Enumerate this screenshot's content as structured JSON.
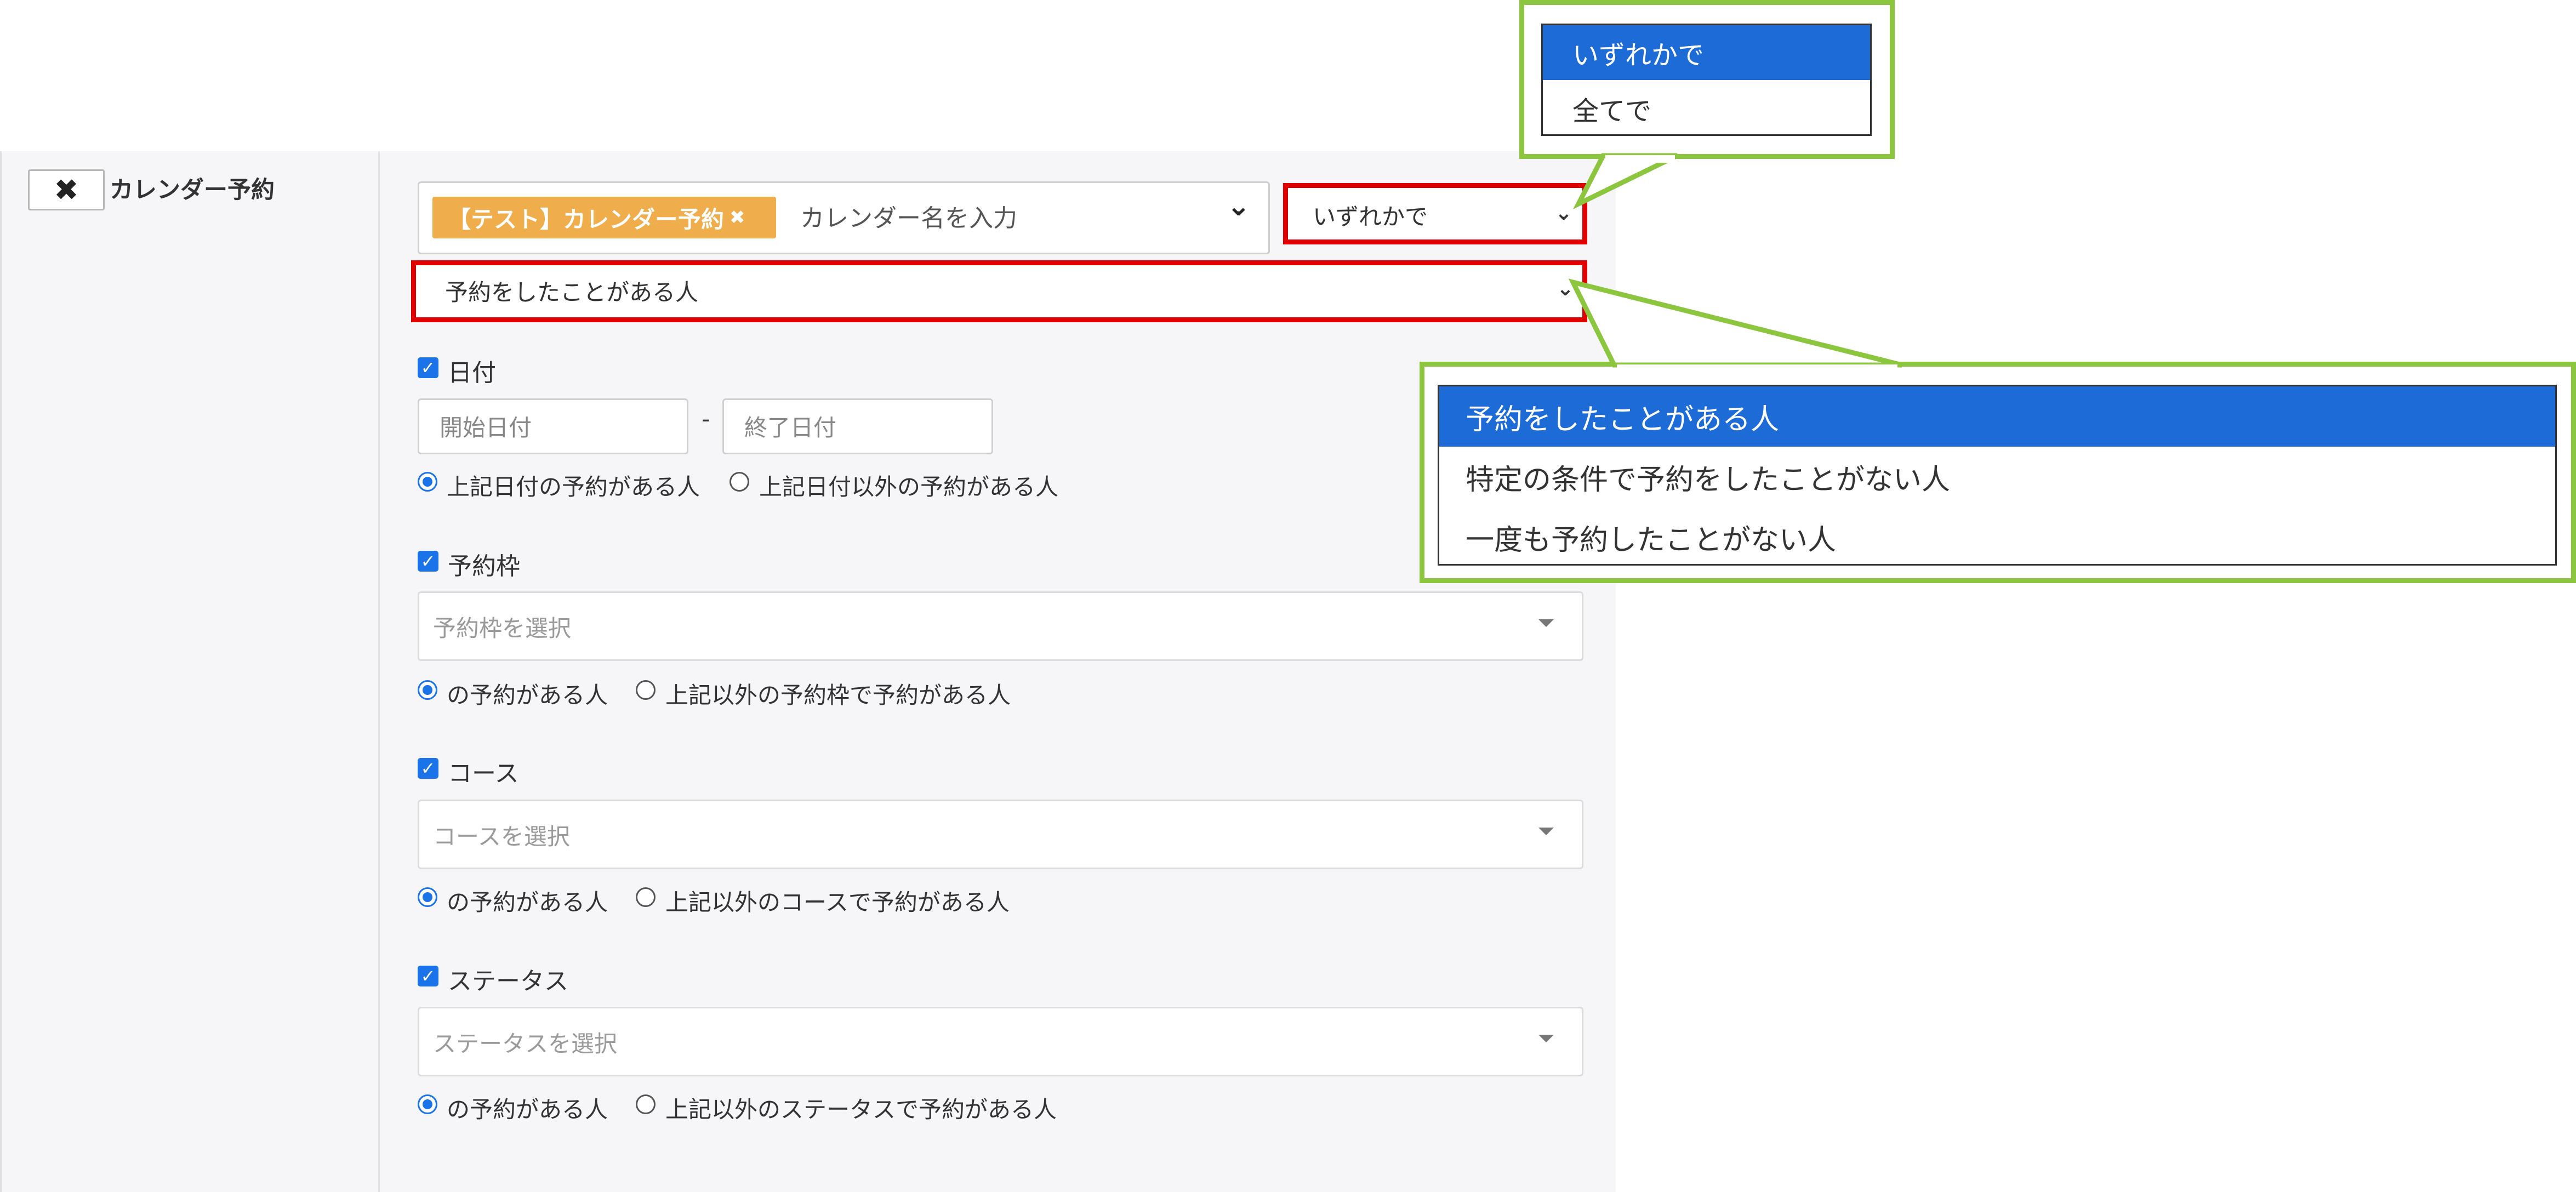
{
  "filter": {
    "remove_icon": "✖",
    "section_label": "カレンダー予約",
    "calendar": {
      "tag_label": "【テスト】カレンダー予約",
      "tag_remove": "✖",
      "placeholder": "カレンダー名を入力"
    },
    "match_mode": {
      "value": "いずれかで"
    },
    "reservation_type": {
      "value": "予約をしたことがある人"
    },
    "date": {
      "checkbox_label": "日付",
      "start_placeholder": "開始日付",
      "separator": "-",
      "end_placeholder": "終了日付",
      "radio_in": "上記日付の予約がある人",
      "radio_out": "上記日付以外の予約がある人"
    },
    "slot": {
      "checkbox_label": "予約枠",
      "placeholder": "予約枠を選択",
      "radio_in": "の予約がある人",
      "radio_out": "上記以外の予約枠で予約がある人"
    },
    "course": {
      "checkbox_label": "コース",
      "placeholder": "コースを選択",
      "radio_in": "の予約がある人",
      "radio_out": "上記以外のコースで予約がある人"
    },
    "status": {
      "checkbox_label": "ステータス",
      "placeholder": "ステータスを選択",
      "radio_in": "の予約がある人",
      "radio_out": "上記以外のステータスで予約がある人"
    }
  },
  "callouts": {
    "match_mode_options": [
      "いずれかで",
      "全てで"
    ],
    "reservation_type_options": [
      "予約をしたことがある人",
      "特定の条件で予約をしたことがない人",
      "一度も予約したことがない人"
    ]
  },
  "colors": {
    "highlight_border": "#e00000",
    "callout_border": "#8cc63f",
    "selected_option": "#1c6bd7",
    "tag_background": "#efad4b",
    "accent": "#1a73e8"
  }
}
